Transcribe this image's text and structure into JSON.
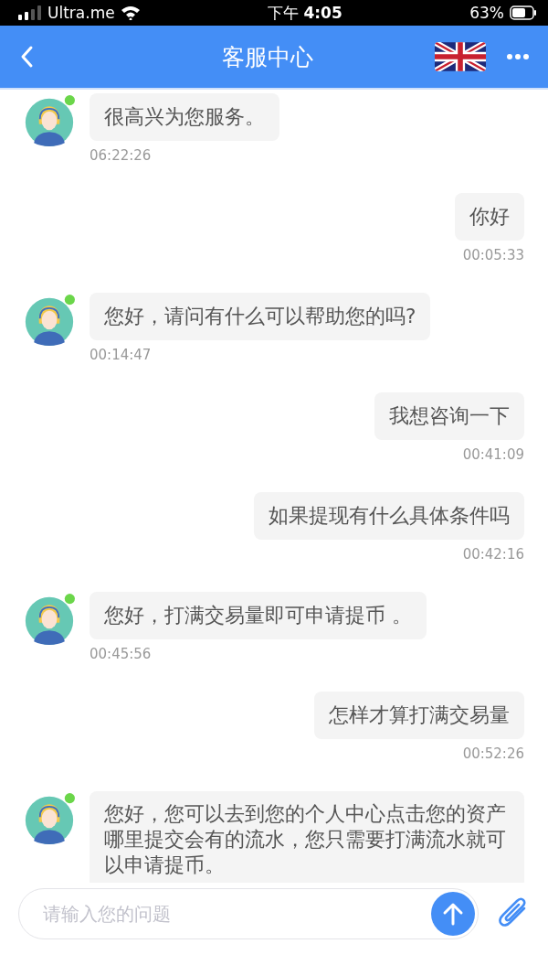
{
  "status_bar": {
    "carrier": "Ultra.me",
    "time": "下午 **4:05**",
    "battery": "63%"
  },
  "header": {
    "title": "客服中心"
  },
  "messages": [
    {
      "kind": "agent",
      "text": "很高兴为您服务。",
      "time": "06:22:26"
    },
    {
      "kind": "user",
      "text": "你好",
      "time": "00:05:33"
    },
    {
      "kind": "agent",
      "text": "您好，请问有什么可以帮助您的吗?",
      "time": "00:14:47"
    },
    {
      "kind": "user",
      "text": "我想咨询一下",
      "time": "00:41:09"
    },
    {
      "kind": "user",
      "text": "如果提现有什么具体条件吗",
      "time": "00:42:16"
    },
    {
      "kind": "agent",
      "text": "您好，打满交易量即可申请提币 。",
      "time": "00:45:56"
    },
    {
      "kind": "user",
      "text": "怎样才算打满交易量",
      "time": "00:52:26"
    },
    {
      "kind": "agent",
      "text": "您好，您可以去到您的个人中心点击您的资产哪里提交会有的流水，您只需要打满流水就可以申请提币。"
    }
  ],
  "input": {
    "placeholder": "请输入您的问题"
  }
}
